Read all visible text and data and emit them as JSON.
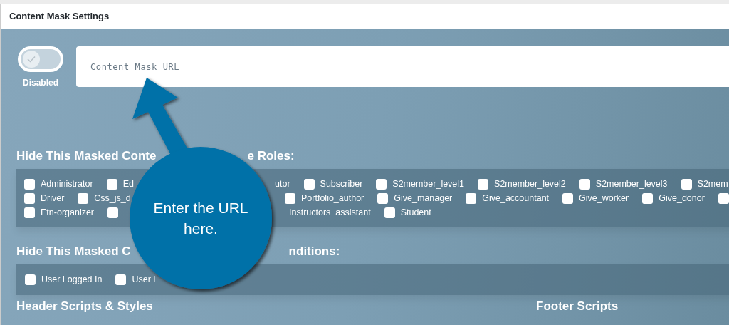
{
  "panel_title": "Content Mask Settings",
  "toggle": {
    "on": false,
    "label": "Disabled"
  },
  "url_field": {
    "placeholder": "Content Mask URL"
  },
  "roles_section": {
    "heading_left": "Hide This Masked Conte",
    "heading_right": "e Roles:",
    "rows": [
      {
        "left_of_callout": [
          {
            "label": "Administrator",
            "checked": false
          },
          {
            "label": "Ed",
            "checked": false
          }
        ],
        "right_of_callout": [
          {
            "label": "utor"
          },
          {
            "label": "Subscriber",
            "checked": false
          },
          {
            "label": "S2member_level1",
            "checked": false
          },
          {
            "label": "S2member_level2",
            "checked": false
          },
          {
            "label": "S2member_level3",
            "checked": false
          },
          {
            "label": "S2mem",
            "checked": false
          }
        ]
      },
      {
        "left_of_callout": [
          {
            "label": "Driver",
            "checked": false
          },
          {
            "label": "Css_js_d",
            "checked": false
          }
        ],
        "right_of_callout": [
          {
            "checked": false,
            "label": "Portfolio_author"
          },
          {
            "label": "Give_manager",
            "checked": false
          },
          {
            "label": "Give_accountant",
            "checked": false
          },
          {
            "label": "Give_worker",
            "checked": false
          },
          {
            "label": "Give_donor",
            "checked": false
          },
          {
            "checked": false
          }
        ]
      },
      {
        "left_of_callout": [
          {
            "label": "Etn-organizer",
            "checked": false
          },
          {
            "checked": false
          }
        ],
        "right_of_callout": [
          {
            "label": "Instructors_assistant"
          },
          {
            "label": "Student",
            "checked": false
          }
        ]
      }
    ]
  },
  "conditions_section": {
    "heading_left": "Hide This Masked C",
    "heading_right": "nditions:",
    "items": [
      {
        "label": "User Logged In",
        "checked": false
      },
      {
        "label": "User L",
        "checked": false
      }
    ]
  },
  "bottom_headings": [
    "Header Scripts & Styles",
    "Footer Scripts"
  ],
  "callout": {
    "text": "Enter the URL here."
  }
}
